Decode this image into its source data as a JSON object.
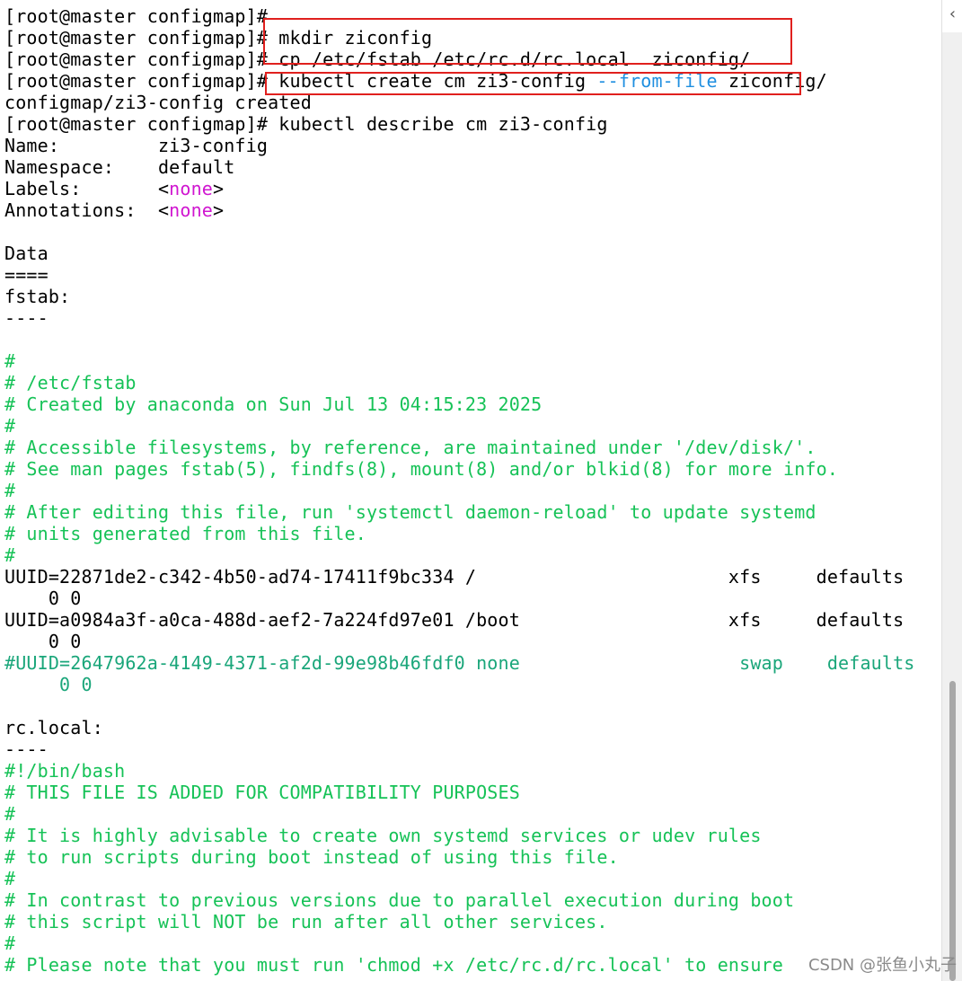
{
  "terminal": {
    "lines": [
      [
        {
          "t": "[root@master configmap]#"
        }
      ],
      [
        {
          "t": "[root@master configmap]# mkdir ziconfig"
        }
      ],
      [
        {
          "t": "[root@master configmap]# cp /etc/fstab /etc/rc.d/rc.local  ziconfig/"
        }
      ],
      [
        {
          "t": "[root@master configmap]# kubectl create cm zi3-config "
        },
        {
          "t": "--from-file",
          "c": "blue"
        },
        {
          "t": " ziconfig/"
        }
      ],
      [
        {
          "t": "configmap/zi3-config created"
        }
      ],
      [
        {
          "t": "[root@master configmap]# kubectl describe cm zi3-config"
        }
      ],
      [
        {
          "t": "Name:         zi3-config"
        }
      ],
      [
        {
          "t": "Namespace:    default"
        }
      ],
      [
        {
          "t": "Labels:       <"
        },
        {
          "t": "none",
          "c": "magenta"
        },
        {
          "t": ">"
        }
      ],
      [
        {
          "t": "Annotations:  <"
        },
        {
          "t": "none",
          "c": "magenta"
        },
        {
          "t": ">"
        }
      ],
      [
        {
          "t": ""
        }
      ],
      [
        {
          "t": "Data"
        }
      ],
      [
        {
          "t": "===="
        }
      ],
      [
        {
          "t": "fstab:"
        }
      ],
      [
        {
          "t": "----"
        }
      ],
      [
        {
          "t": ""
        }
      ],
      [
        {
          "t": "#",
          "c": "green"
        }
      ],
      [
        {
          "t": "# /etc/fstab",
          "c": "green"
        }
      ],
      [
        {
          "t": "# Created by anaconda on Sun Jul 13 04:15:23 2025",
          "c": "green"
        }
      ],
      [
        {
          "t": "#",
          "c": "green"
        }
      ],
      [
        {
          "t": "# Accessible filesystems, by reference, are maintained under '/dev/disk/'.",
          "c": "green"
        }
      ],
      [
        {
          "t": "# See man pages fstab(5), findfs(8), mount(8) and/or blkid(8) for more info.",
          "c": "green"
        }
      ],
      [
        {
          "t": "#",
          "c": "green"
        }
      ],
      [
        {
          "t": "# After editing this file, run 'systemctl daemon-reload' to update systemd",
          "c": "green"
        }
      ],
      [
        {
          "t": "# units generated from this file.",
          "c": "green"
        }
      ],
      [
        {
          "t": "#",
          "c": "green"
        }
      ],
      [
        {
          "t": "UUID=22871de2-c342-4b50-ad74-17411f9bc334 /                       xfs     defaults"
        }
      ],
      [
        {
          "t": "    0 0"
        }
      ],
      [
        {
          "t": "UUID=a0984a3f-a0ca-488d-aef2-7a224fd97e01 /boot                   xfs     defaults"
        }
      ],
      [
        {
          "t": "    0 0"
        }
      ],
      [
        {
          "t": "#UUID=2647962a-4149-4371-af2d-99e98b46fdf0 none                    swap    defaults",
          "c": "teal"
        }
      ],
      [
        {
          "t": "     0 0",
          "c": "teal"
        }
      ],
      [
        {
          "t": ""
        }
      ],
      [
        {
          "t": "rc.local:"
        }
      ],
      [
        {
          "t": "----"
        }
      ],
      [
        {
          "t": "#!/bin/bash",
          "c": "green"
        }
      ],
      [
        {
          "t": "# THIS FILE IS ADDED FOR COMPATIBILITY PURPOSES",
          "c": "green"
        }
      ],
      [
        {
          "t": "#",
          "c": "green"
        }
      ],
      [
        {
          "t": "# It is highly advisable to create own systemd services or udev rules",
          "c": "green"
        }
      ],
      [
        {
          "t": "# to run scripts during boot instead of using this file.",
          "c": "green"
        }
      ],
      [
        {
          "t": "#",
          "c": "green"
        }
      ],
      [
        {
          "t": "# In contrast to previous versions due to parallel execution during boot",
          "c": "green"
        }
      ],
      [
        {
          "t": "# this script will NOT be run after all other services.",
          "c": "green"
        }
      ],
      [
        {
          "t": "#",
          "c": "green"
        }
      ],
      [
        {
          "t": "# Please note that you must run 'chmod +x /etc/rc.d/rc.local' to ensure",
          "c": "green"
        }
      ]
    ]
  },
  "scrollbar": {
    "collapse_glyph": "‹"
  },
  "watermark": {
    "text": "CSDN @张鱼小丸子"
  }
}
